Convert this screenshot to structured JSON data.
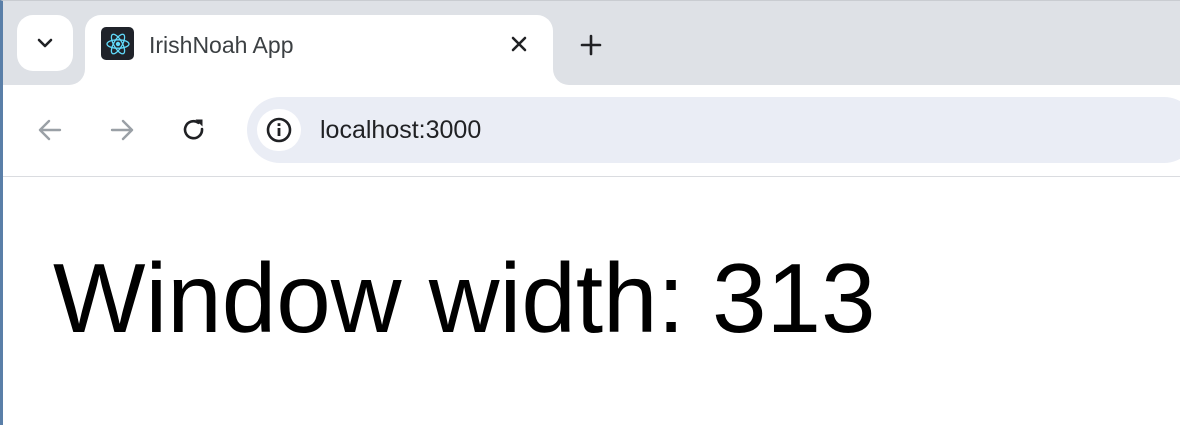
{
  "tab": {
    "title": "IrishNoah App",
    "favicon": "react-logo-icon",
    "close_icon": "close-icon"
  },
  "tab_strip": {
    "tab_search_icon": "chevron-down-icon",
    "new_tab_icon": "plus-icon"
  },
  "toolbar": {
    "back_icon": "arrow-left-icon",
    "forward_icon": "arrow-right-icon",
    "reload_icon": "reload-icon",
    "site_info_icon": "info-icon",
    "url": "localhost:3000"
  },
  "page": {
    "heading": "Window width: 313"
  },
  "colors": {
    "tabstrip_bg": "#dee1e6",
    "omnibox_bg": "#eaedf5",
    "react_cyan": "#61dafb",
    "favicon_bg": "#20232a"
  }
}
